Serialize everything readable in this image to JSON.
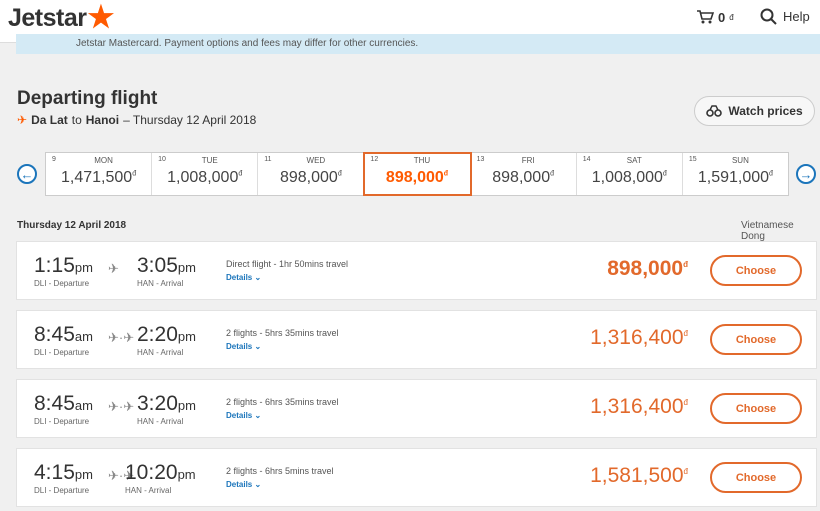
{
  "header": {
    "logo_text": "Jetstar",
    "cart_amount": "0",
    "cart_currency": "đ",
    "help_label": "Help"
  },
  "notice": {
    "text": "Jetstar Mastercard. Payment options and fees may differ for other currencies."
  },
  "page": {
    "title": "Departing flight",
    "origin": "Da Lat",
    "to": "to",
    "destination": "Hanoi",
    "date_text": "– Thursday 12 April 2018",
    "watch_label": "Watch prices"
  },
  "date_strip": [
    {
      "num": "9",
      "day": "MON",
      "price": "1,471,500",
      "cur": "đ",
      "selected": false
    },
    {
      "num": "10",
      "day": "TUE",
      "price": "1,008,000",
      "cur": "đ",
      "selected": false
    },
    {
      "num": "11",
      "day": "WED",
      "price": "898,000",
      "cur": "đ",
      "selected": false
    },
    {
      "num": "12",
      "day": "THU",
      "price": "898,000",
      "cur": "đ",
      "selected": true
    },
    {
      "num": "13",
      "day": "FRI",
      "price": "898,000",
      "cur": "đ",
      "selected": false
    },
    {
      "num": "14",
      "day": "SAT",
      "price": "1,008,000",
      "cur": "đ",
      "selected": false
    },
    {
      "num": "15",
      "day": "SUN",
      "price": "1,591,000",
      "cur": "đ",
      "selected": false
    }
  ],
  "section": {
    "date": "Thursday 12 April 2018",
    "currency": "Vietnamese Dong"
  },
  "flights": [
    {
      "dep_time": "1:15",
      "dep_ampm": "pm",
      "dep_label": "DLI - Departure",
      "arr_time": "3:05",
      "arr_ampm": "pm",
      "arr_label": "HAN - Arrival",
      "info": "Direct flight - 1hr 50mins travel",
      "details": "Details",
      "price": "898,000",
      "cur": "đ",
      "choose": "Choose"
    },
    {
      "dep_time": "8:45",
      "dep_ampm": "am",
      "dep_label": "DLI - Departure",
      "arr_time": "2:20",
      "arr_ampm": "pm",
      "arr_label": "HAN - Arrival",
      "info": "2 flights - 5hrs 35mins travel",
      "details": "Details",
      "price": "1,316,400",
      "cur": "đ",
      "choose": "Choose"
    },
    {
      "dep_time": "8:45",
      "dep_ampm": "am",
      "dep_label": "DLI - Departure",
      "arr_time": "3:20",
      "arr_ampm": "pm",
      "arr_label": "HAN - Arrival",
      "info": "2 flights - 6hrs 35mins travel",
      "details": "Details",
      "price": "1,316,400",
      "cur": "đ",
      "choose": "Choose"
    },
    {
      "dep_time": "4:15",
      "dep_ampm": "pm",
      "dep_label": "DLI - Departure",
      "arr_time": "10:20",
      "arr_ampm": "pm",
      "arr_label": "HAN - Arrival",
      "info": "2 flights - 6hrs 5mins travel",
      "details": "Details",
      "price": "1,581,500",
      "cur": "đ",
      "choose": "Choose"
    }
  ],
  "colors": {
    "brand_orange": "#ff5a00",
    "accent_orange": "#e2692b",
    "link_blue": "#1b75bb"
  },
  "icons": {
    "logo": "star-icon",
    "cart": "cart-icon",
    "help": "search-icon",
    "watch": "binoculars-icon",
    "route": "plane-icon"
  }
}
